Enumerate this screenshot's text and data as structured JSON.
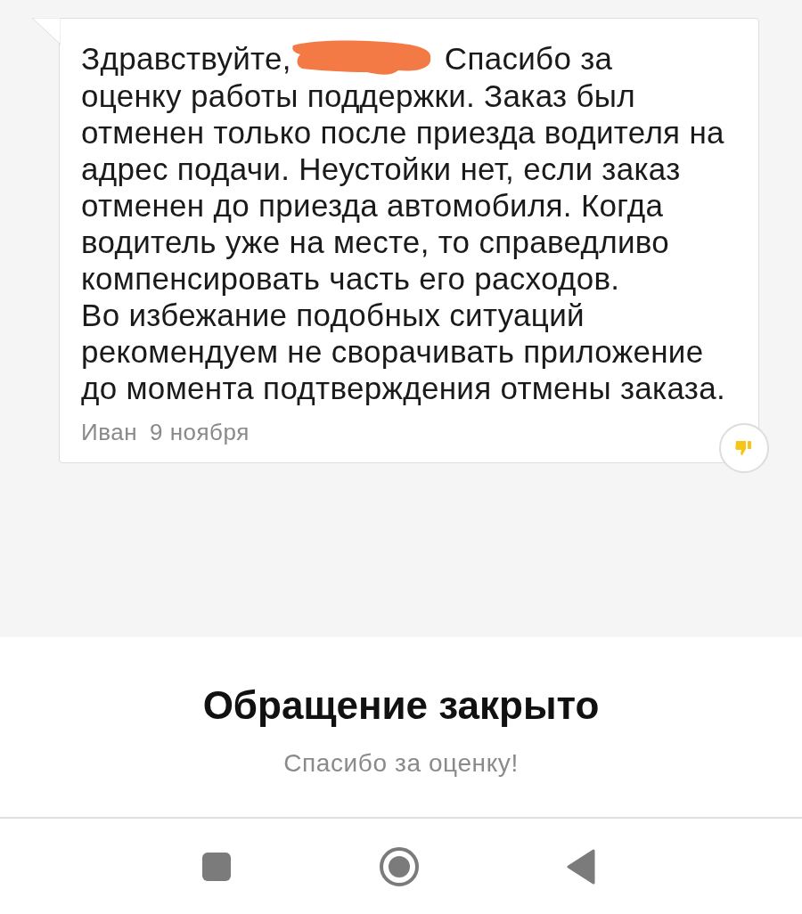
{
  "message": {
    "greeting": "Здравствуйте,",
    "lead": "Спасибо за",
    "paragraphs": [
      "оценку работы поддержки. Заказ был отменен только после приезда водителя на адрес подачи. Неустойки нет, если заказ отменен до приезда автомобиля. Когда водитель уже на месте, то справедливо компенсировать часть его расходов.",
      "Во избежание подобных ситуаций рекомендуем не сворачивать приложение до момента подтверждения отмены заказа."
    ],
    "author": "Иван",
    "date": "9 ноября"
  },
  "status": {
    "title": "Обращение закрыто",
    "subtitle": "Спасибо за оценку!"
  }
}
